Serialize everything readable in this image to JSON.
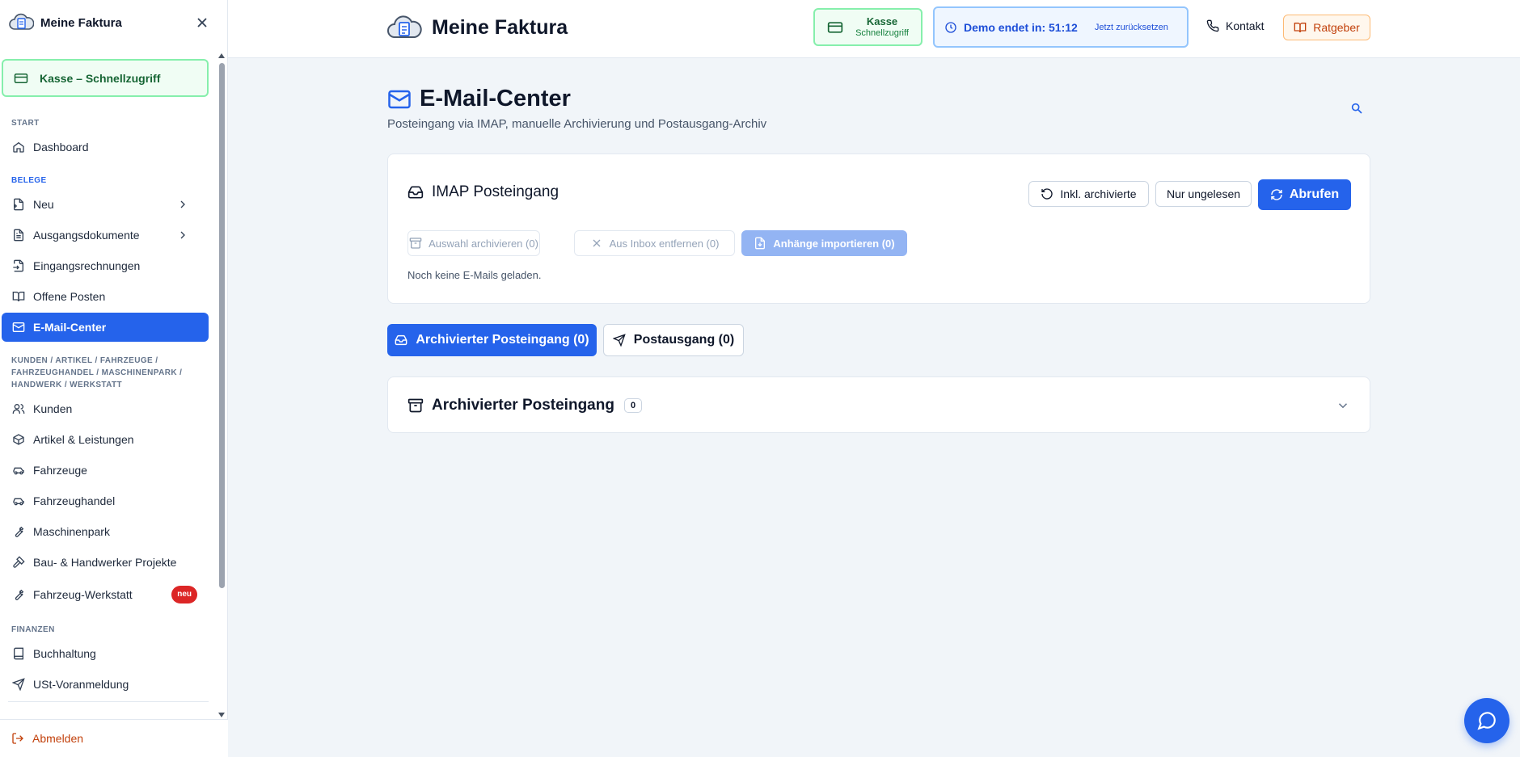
{
  "sidebar": {
    "title": "Meine Faktura",
    "kasse_label": "Kasse – Schnellzugriff",
    "sections": {
      "start": "START",
      "belege": "BELEGE",
      "kunden": "KUNDEN / ARTIKEL / FAHRZEUGE / FAHRZEUGHANDEL / MASCHINENPARK / HANDWERK / WERKSTATT",
      "finanzen": "FINANZEN"
    },
    "items": {
      "dashboard": "Dashboard",
      "neu": "Neu",
      "ausgang": "Ausgangsdokumente",
      "eingang": "Eingangsrechnungen",
      "offen": "Offene Posten",
      "email": "E-Mail-Center",
      "kunden": "Kunden",
      "artikel": "Artikel & Leistungen",
      "fahrzeuge": "Fahrzeuge",
      "handel": "Fahrzeughandel",
      "maschinen": "Maschinenpark",
      "bau": "Bau- & Handwerker Projekte",
      "werkstatt": "Fahrzeug-Werkstatt",
      "buchhaltung": "Buchhaltung",
      "ust": "USt-Voranmeldung"
    },
    "werkstatt_badge": "neu",
    "logout": "Abmelden"
  },
  "topbar": {
    "brand": "Meine Faktura",
    "kasse_title": "Kasse",
    "kasse_sub": "Schnellzugriff",
    "demo_text": "Demo endet in: 51:12",
    "demo_reset": "Jetzt zurücksetzen",
    "contact": "Kontakt",
    "ratgeber": "Ratgeber"
  },
  "main": {
    "title": "E-Mail-Center",
    "subtitle": "Posteingang via IMAP, manuelle Archivierung und Postausgang-Archiv",
    "imap": {
      "title": "IMAP Posteingang",
      "btn_archived": "Inkl. archivierte",
      "btn_unread": "Nur ungelesen",
      "btn_fetch": "Abrufen",
      "btn_archive_sel": "Auswahl archivieren (0)",
      "btn_remove": "Aus Inbox entfernen (0)",
      "btn_import": "Anhänge importieren (0)",
      "empty": "Noch keine E-Mails geladen."
    },
    "tabs": {
      "archived": "Archivierter Posteingang (0)",
      "outbox": "Postausgang (0)"
    },
    "archive_panel": {
      "title": "Archivierter Posteingang",
      "count": "0"
    }
  },
  "colors": {
    "primary": "#2563eb",
    "success_border": "#86efac",
    "danger": "#dc2626",
    "orange": "#c2410c"
  }
}
